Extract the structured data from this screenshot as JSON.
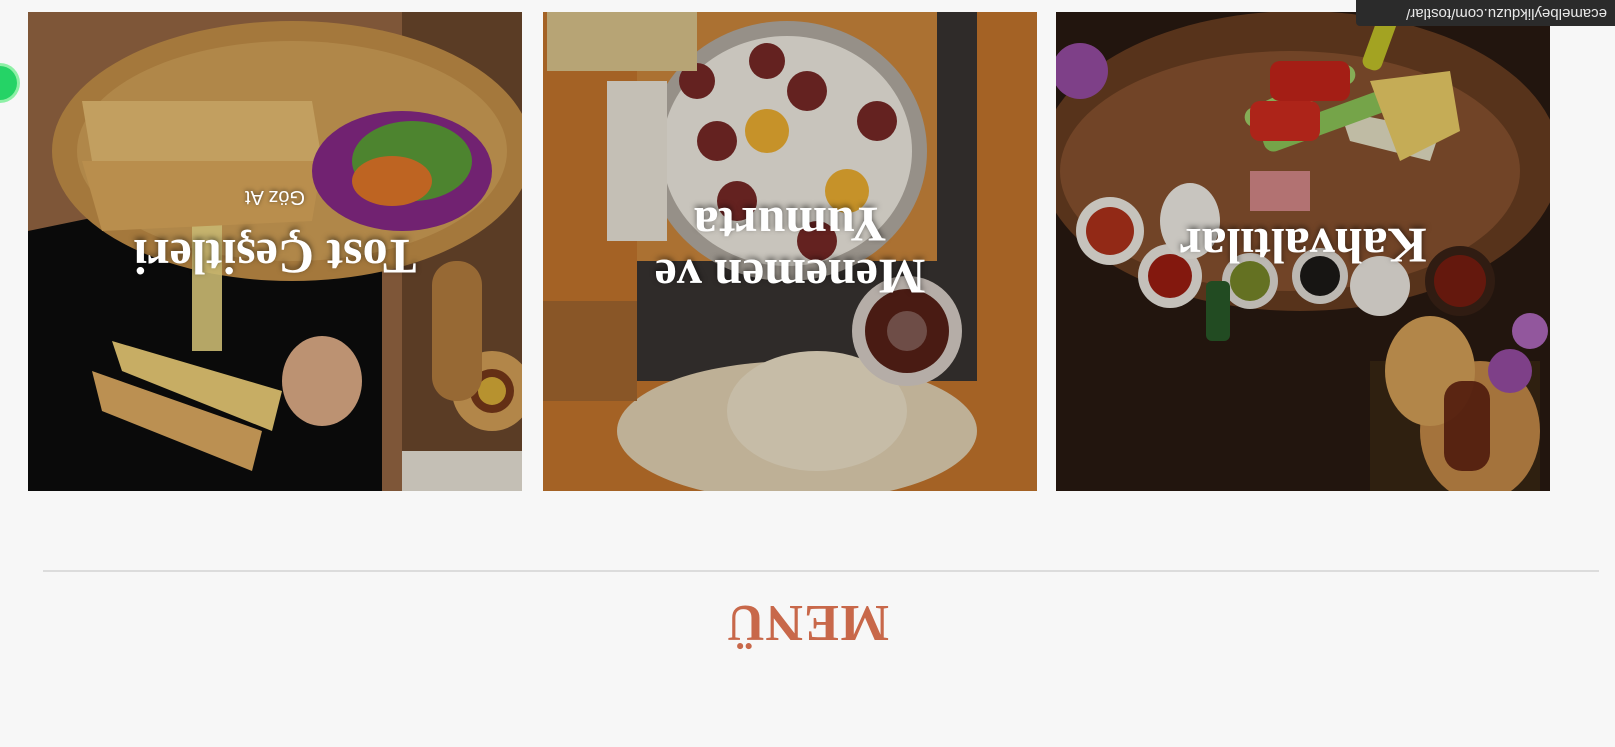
{
  "section": {
    "heading": "MENÜ"
  },
  "cards": [
    {
      "title": "Kahvaltılar",
      "cta": "",
      "icon": "breakfast-platter-photo"
    },
    {
      "title_line1": "Menemen ve",
      "title_line2": "Yumurta",
      "cta": "",
      "icon": "menemen-pan-photo"
    },
    {
      "title": "Tost Çeşitleri",
      "cta": "Göz At",
      "icon": "toast-sandwich-photo"
    }
  ],
  "status_bar": {
    "url": "ecamelbeylikduzu.com/tostlar/"
  },
  "floating_button": {
    "icon": "whatsapp-icon",
    "color": "#25d366"
  },
  "colors": {
    "accent": "#c8684a",
    "background": "#f7f7f7"
  }
}
